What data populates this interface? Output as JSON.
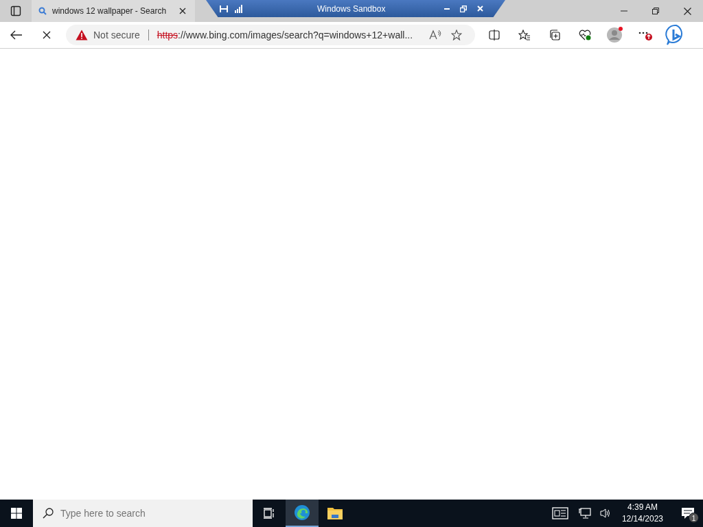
{
  "sandbox_bar": {
    "title": "Windows Sandbox"
  },
  "tabs": [
    {
      "title": "windows 12 wallpaper - Search",
      "selected": true
    }
  ],
  "address_bar": {
    "security_label": "Not secure",
    "url_scheme": "https",
    "url_rest": "://www.bing.com/images/search?q=windows+12+wall..."
  },
  "taskbar": {
    "search": {
      "placeholder": "Type here to search"
    },
    "apps": [
      {
        "kind": "edge",
        "selected": true
      },
      {
        "kind": "explorer",
        "selected": false
      }
    ],
    "clock": {
      "time": "4:39 AM",
      "date": "12/14/2023"
    },
    "notifications": {
      "count": "1"
    }
  }
}
